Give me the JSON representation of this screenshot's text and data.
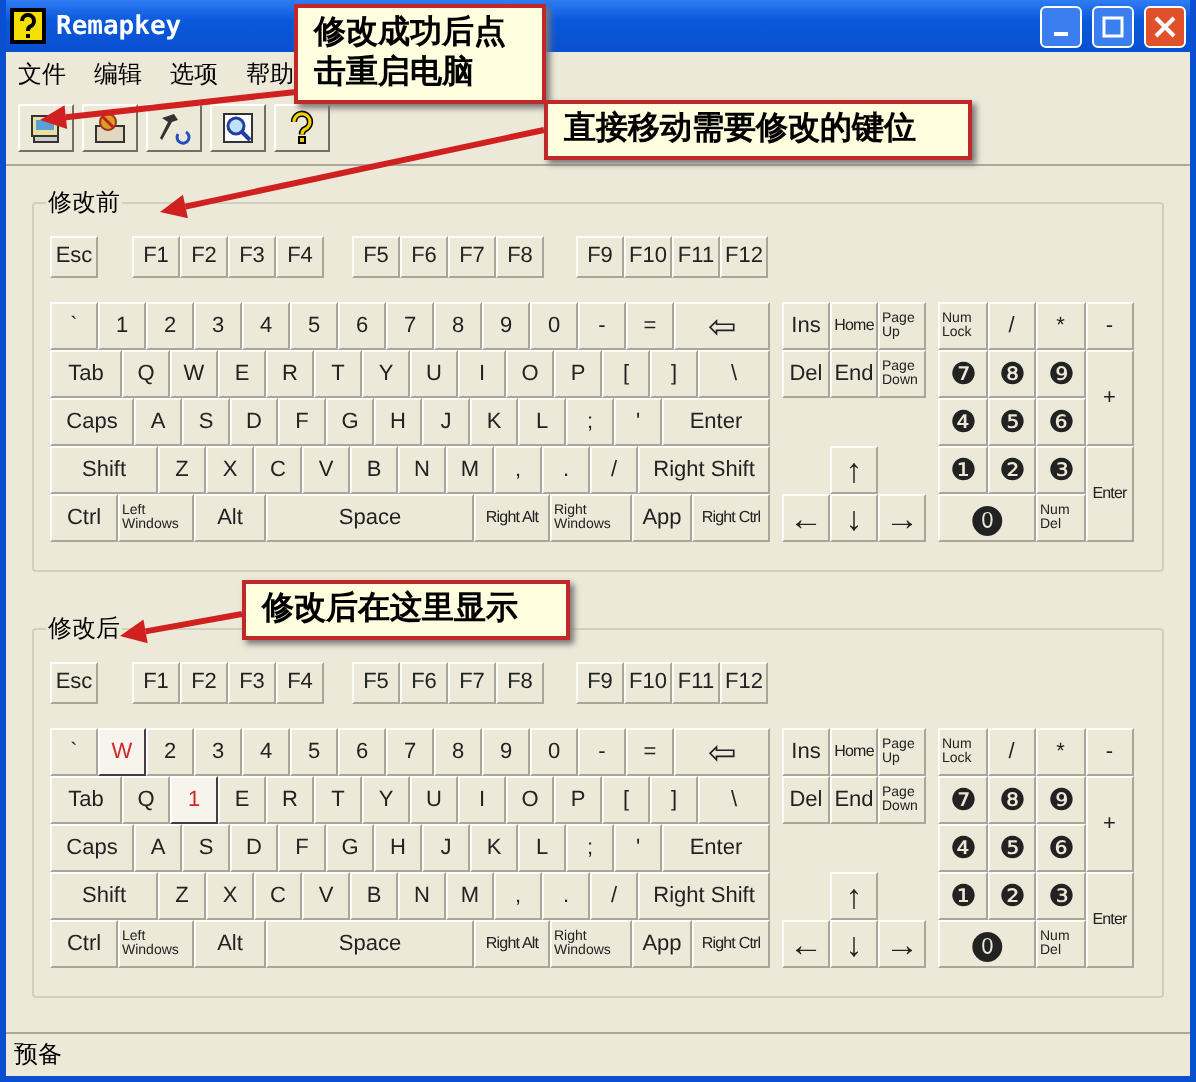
{
  "window": {
    "title": "Remapkey"
  },
  "menu": [
    "文件",
    "编辑",
    "选项",
    "帮助"
  ],
  "keyboards": [
    {
      "title": "修改前",
      "function_row": [
        "Esc",
        "F1",
        "F2",
        "F3",
        "F4",
        "F5",
        "F6",
        "F7",
        "F8",
        "F9",
        "F10",
        "F11",
        "F12"
      ],
      "main_rows": [
        [
          "`",
          "1",
          "2",
          "3",
          "4",
          "5",
          "6",
          "7",
          "8",
          "9",
          "0",
          "-",
          "=",
          {
            "label": "⇦",
            "kind": "arrow"
          }
        ],
        [
          "Tab",
          "Q",
          "W",
          "E",
          "R",
          "T",
          "Y",
          "U",
          "I",
          "O",
          "P",
          "[",
          "]",
          "\\"
        ],
        [
          "Caps",
          "A",
          "S",
          "D",
          "F",
          "G",
          "H",
          "J",
          "K",
          "L",
          ";",
          "'",
          "Enter"
        ],
        [
          "Shift",
          "Z",
          "X",
          "C",
          "V",
          "B",
          "N",
          "M",
          ",",
          ".",
          "/",
          "Right Shift"
        ],
        [
          "Ctrl",
          {
            "label": "Left Windows",
            "kind": "small"
          },
          "Alt",
          "Space",
          {
            "label": "Right Alt",
            "kind": "compact"
          },
          {
            "label": "Right Windows",
            "kind": "small"
          },
          "App",
          {
            "label": "Right Ctrl",
            "kind": "compact"
          }
        ]
      ],
      "nav": [
        "Ins",
        {
          "label": "Home",
          "kind": "compact"
        },
        {
          "label": "Page Up",
          "kind": "small"
        },
        "Del",
        "End",
        {
          "label": "Page Down",
          "kind": "small"
        },
        {
          "label": "↑",
          "kind": "arrow"
        },
        {
          "label": "←",
          "kind": "arrow"
        },
        {
          "label": "↓",
          "kind": "arrow"
        },
        {
          "label": "→",
          "kind": "arrow"
        }
      ],
      "numpad": [
        {
          "label": "Num Lock",
          "kind": "small"
        },
        "/",
        "*",
        "-",
        {
          "label": "❼",
          "kind": "digit"
        },
        {
          "label": "❽",
          "kind": "digit"
        },
        {
          "label": "❾",
          "kind": "digit"
        },
        "+",
        {
          "label": "❹",
          "kind": "digit"
        },
        {
          "label": "❺",
          "kind": "digit"
        },
        {
          "label": "❻",
          "kind": "digit"
        },
        {
          "label": "❶",
          "kind": "digit"
        },
        {
          "label": "❷",
          "kind": "digit"
        },
        {
          "label": "❸",
          "kind": "digit"
        },
        {
          "label": "Enter",
          "kind": "compact"
        },
        {
          "label": "⓿",
          "kind": "digit"
        },
        {
          "label": "Num Del",
          "kind": "small"
        }
      ]
    },
    {
      "title": "修改后",
      "function_row": [
        "Esc",
        "F1",
        "F2",
        "F3",
        "F4",
        "F5",
        "F6",
        "F7",
        "F8",
        "F9",
        "F10",
        "F11",
        "F12"
      ],
      "main_rows": [
        [
          "`",
          {
            "label": "W",
            "remapped": true
          },
          "2",
          "3",
          "4",
          "5",
          "6",
          "7",
          "8",
          "9",
          "0",
          "-",
          "=",
          {
            "label": "⇦",
            "kind": "arrow"
          }
        ],
        [
          "Tab",
          "Q",
          {
            "label": "1",
            "remapped": true
          },
          "E",
          "R",
          "T",
          "Y",
          "U",
          "I",
          "O",
          "P",
          "[",
          "]",
          "\\"
        ],
        [
          "Caps",
          "A",
          "S",
          "D",
          "F",
          "G",
          "H",
          "J",
          "K",
          "L",
          ";",
          "'",
          "Enter"
        ],
        [
          "Shift",
          "Z",
          "X",
          "C",
          "V",
          "B",
          "N",
          "M",
          ",",
          ".",
          "/",
          "Right Shift"
        ],
        [
          "Ctrl",
          {
            "label": "Left Windows",
            "kind": "small"
          },
          "Alt",
          "Space",
          {
            "label": "Right Alt",
            "kind": "compact"
          },
          {
            "label": "Right Windows",
            "kind": "small"
          },
          "App",
          {
            "label": "Right Ctrl",
            "kind": "compact"
          }
        ]
      ],
      "nav": [
        "Ins",
        {
          "label": "Home",
          "kind": "compact"
        },
        {
          "label": "Page Up",
          "kind": "small"
        },
        "Del",
        "End",
        {
          "label": "Page Down",
          "kind": "small"
        },
        {
          "label": "↑",
          "kind": "arrow"
        },
        {
          "label": "←",
          "kind": "arrow"
        },
        {
          "label": "↓",
          "kind": "arrow"
        },
        {
          "label": "→",
          "kind": "arrow"
        }
      ],
      "numpad": [
        {
          "label": "Num Lock",
          "kind": "small"
        },
        "/",
        "*",
        "-",
        {
          "label": "❼",
          "kind": "digit"
        },
        {
          "label": "❽",
          "kind": "digit"
        },
        {
          "label": "❾",
          "kind": "digit"
        },
        "+",
        {
          "label": "❹",
          "kind": "digit"
        },
        {
          "label": "❺",
          "kind": "digit"
        },
        {
          "label": "❻",
          "kind": "digit"
        },
        {
          "label": "❶",
          "kind": "digit"
        },
        {
          "label": "❷",
          "kind": "digit"
        },
        {
          "label": "❸",
          "kind": "digit"
        },
        {
          "label": "Enter",
          "kind": "compact"
        },
        {
          "label": "⓿",
          "kind": "digit"
        },
        {
          "label": "Num Del",
          "kind": "small"
        }
      ]
    }
  ],
  "callouts": [
    {
      "text": "修改成功后点击重启电脑"
    },
    {
      "text": "直接移动需要修改的键位"
    },
    {
      "text": "修改后在这里显示"
    }
  ],
  "status_bar": "预备"
}
